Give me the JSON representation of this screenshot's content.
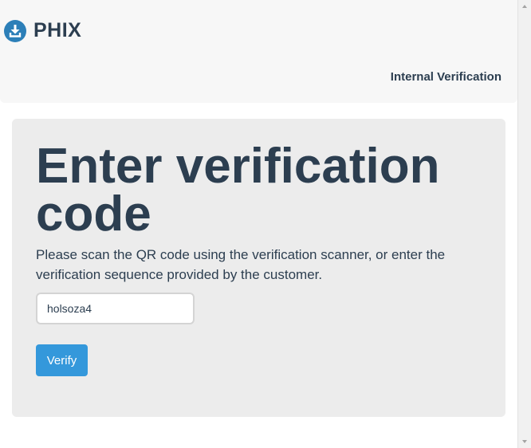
{
  "header": {
    "brand_name": "PHIX",
    "brand_icon": "download-circle-icon",
    "nav_link": "Internal Verification"
  },
  "main": {
    "title": "Enter verification code",
    "description": "Please scan the QR code using the verification scanner, or enter the verification sequence provided by the customer.",
    "code_input_value": "holsoza4",
    "verify_button_label": "Verify"
  },
  "colors": {
    "primary_text": "#2c3e50",
    "accent": "#3498db",
    "navbar_bg": "#f7f7f7",
    "panel_bg": "#ececec"
  }
}
